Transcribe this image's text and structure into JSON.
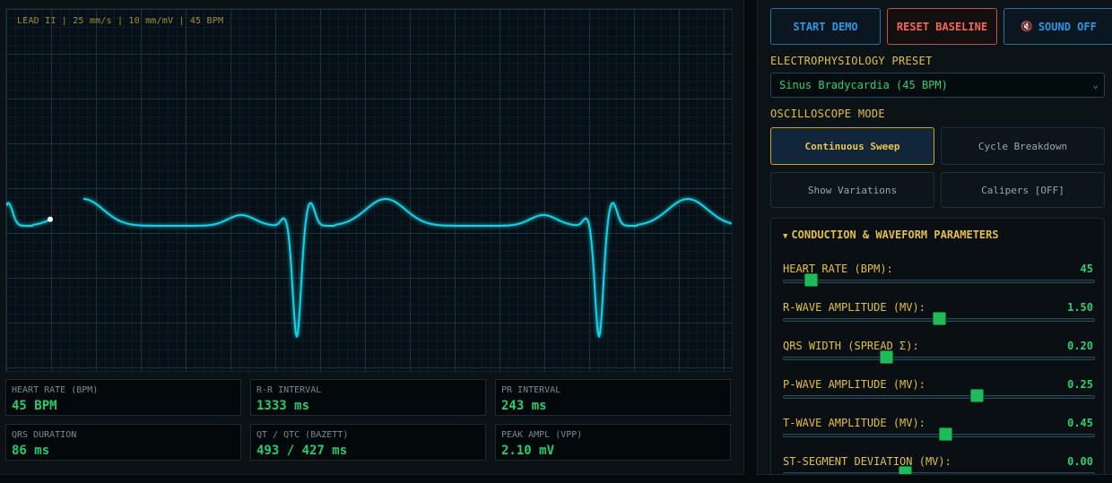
{
  "monitor": {
    "lead_info": "LEAD II | 25 mm/s | 10 mm/mV | 45 BPM",
    "trace_color": "#19d2e6"
  },
  "stats": [
    {
      "label": "HEART RATE (BPM)",
      "value": "45 BPM"
    },
    {
      "label": "R-R INTERVAL",
      "value": "1333 ms"
    },
    {
      "label": "PR INTERVAL",
      "value": "243 ms"
    },
    {
      "label": "QRS DURATION",
      "value": "86 ms"
    },
    {
      "label": "QT / QTC (BAZETT)",
      "value": "493 / 427 ms"
    },
    {
      "label": "PEAK AMPL (VPP)",
      "value": "2.10 mV"
    }
  ],
  "controls": {
    "start_label": "START DEMO",
    "reset_label": "RESET BASELINE",
    "sound_icon": "🔇",
    "sound_label": "SOUND OFF",
    "preset_heading": "ELECTROPHYSIOLOGY PRESET",
    "preset_value": "Sinus Bradycardia (45 BPM)",
    "mode_heading": "OSCILLOSCOPE MODE",
    "modes": [
      {
        "label": "Continuous Sweep",
        "active": true
      },
      {
        "label": "Cycle Breakdown",
        "active": false
      },
      {
        "label": "Show Variations",
        "active": false
      },
      {
        "label": "Calipers [OFF]",
        "active": false
      }
    ]
  },
  "params": {
    "header": "CONDUCTION & WAVEFORM PARAMETERS",
    "items": [
      {
        "label": "HEART RATE (BPM):",
        "value": "45",
        "level": 0.09
      },
      {
        "label": "R-WAVE AMPLITUDE (MV):",
        "value": "1.50",
        "level": 0.5
      },
      {
        "label": "QRS WIDTH (SPREAD Σ):",
        "value": "0.20",
        "level": 0.33
      },
      {
        "label": "P-WAVE AMPLITUDE (MV):",
        "value": "0.25",
        "level": 0.62
      },
      {
        "label": "T-WAVE AMPLITUDE (MV):",
        "value": "0.45",
        "level": 0.52
      },
      {
        "label": "ST-SEGMENT DEVIATION (MV):",
        "value": "0.00",
        "level": 0.39
      }
    ]
  },
  "colors": {
    "accent_gold": "#e2bf4a",
    "value_green": "#2fcf71",
    "button_blue": "#2f96e0",
    "button_red": "#f06a57"
  }
}
